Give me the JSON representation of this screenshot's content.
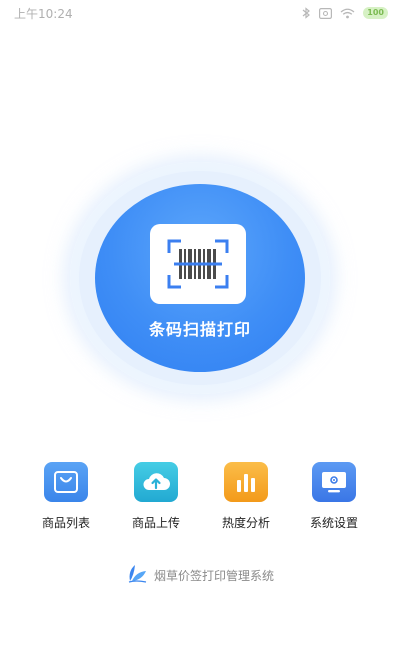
{
  "status_bar": {
    "time": "上午10:24",
    "battery": "100",
    "icons": [
      "bluetooth-icon",
      "alarm-icon",
      "wifi-icon",
      "battery-icon"
    ]
  },
  "scan": {
    "label": "条码扫描打印",
    "icon": "barcode-scan-icon"
  },
  "menu": {
    "items": [
      {
        "label": "商品列表",
        "icon": "shopping-bag-icon",
        "color": "#3f8fee"
      },
      {
        "label": "商品上传",
        "icon": "cloud-upload-icon",
        "color": "#2fb8d6"
      },
      {
        "label": "热度分析",
        "icon": "bar-chart-icon",
        "color": "#f5a623"
      },
      {
        "label": "系统设置",
        "icon": "settings-monitor-icon",
        "color": "#3f7fea"
      }
    ]
  },
  "footer": {
    "text": "烟草价签打印管理系统",
    "icon": "leaf-logo-icon"
  },
  "colors": {
    "primary": "#3f8ef6",
    "halo": "#e6f0fd",
    "text_muted": "#8a8a8a"
  }
}
